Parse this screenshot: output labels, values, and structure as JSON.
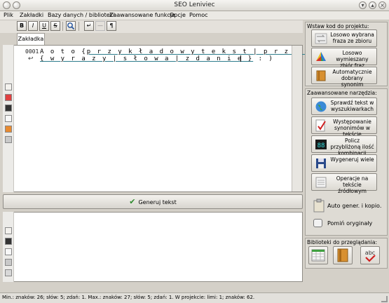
{
  "window": {
    "title": "SEO Leniviec"
  },
  "menu": [
    "Plik",
    "Zakładki",
    "Bazy danych / biblioteki",
    "Zaawansowane funkcje",
    "Opcje",
    "Pomoc"
  ],
  "toolbar": {
    "bold": "B",
    "italic": "I",
    "underline": "U",
    "strike": "S"
  },
  "tab": {
    "label": "Zakładka"
  },
  "editor": {
    "line_number": "0001",
    "line1_plain": "A  o t o  {",
    "line1_link": "p r z y k ł a d o w y  t e k s t | p r z y k ł a d o w e",
    "line2_link": "{ w y r a z y | s ł o w a | z d a n i e }",
    "line2_plain": "  : )"
  },
  "generate": {
    "label": "Generuj tekst"
  },
  "panel": {
    "insert_title": "Wstaw kod do projektu:",
    "insert_buttons": [
      {
        "label": "Losowo wybrana fraza ze zbioru",
        "icon": "arrows-icon"
      },
      {
        "label": "Losowo wymieszany zbiór fraz",
        "icon": "palette-icon"
      },
      {
        "label": "Automatycznie dobrany synonim",
        "icon": "book-icon"
      }
    ],
    "advanced_title": "Zaawansowane narzędzia:",
    "advanced_buttons": [
      {
        "label": "Sprawdź tekst w wyszukiwarkach",
        "icon": "globe-icon"
      },
      {
        "label": "Występowanie synonimów w tekście",
        "icon": "checklist-icon"
      },
      {
        "label": "Policz przybliżoną ilość kombinacji",
        "icon": "counter-icon"
      },
      {
        "label": "Wygeneruj wiele",
        "icon": "disk-icon"
      },
      {
        "label": "Operacje na tekście źródłowym",
        "icon": "notepad-icon"
      }
    ],
    "auto_gen_label": "Auto gener. i kopio.",
    "skip_original_label": "Pomiń oryginały",
    "libraries_title": "Biblioteki do przeglądania:",
    "library_icons": [
      "table-icon",
      "book-icon",
      "spellcheck-icon"
    ],
    "spellcheck_text": "abc"
  },
  "status": {
    "text": "Min.: znaków: 26; słów: 5; zdań: 1. Max.: znaków: 27; słów: 5; zdań: 1. W projekcie: limi: 1; znaków: 62."
  }
}
